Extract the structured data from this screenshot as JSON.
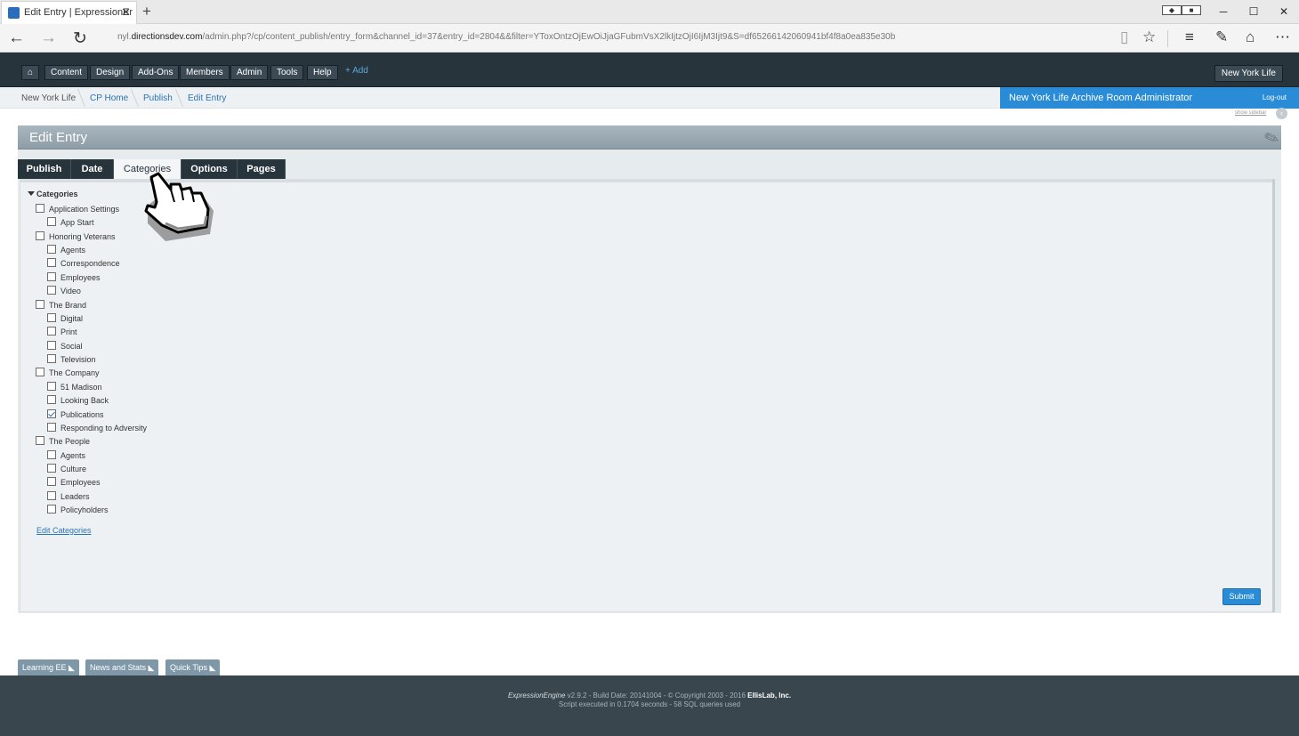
{
  "browser": {
    "tab_title": "Edit Entry | ExpressionEr",
    "url_prefix": "nyl.",
    "url_domain": "directionsdev.com",
    "url_path": "/admin.php?/cp/content_publish/entry_form&channel_id=37&entry_id=2804&&filter=YToxOntzOjEwOiJjaGFubmVsX2lkIjtzOjI6IjM3Ijt9&S=df65266142060941bf4f8a0ea835e30b"
  },
  "nav": {
    "items": [
      "Content",
      "Design",
      "Add-Ons",
      "Members",
      "Admin",
      "Tools",
      "Help"
    ],
    "add_label": "+ Add",
    "site_label": "New York Life"
  },
  "breadcrumb": [
    "New York Life",
    "CP Home",
    "Publish",
    "Edit Entry"
  ],
  "user": {
    "name": "New York Life Archive Room Administrator",
    "logout": "Log-out",
    "show_sidebar": "show sidebar"
  },
  "page": {
    "title": "Edit Entry",
    "tabs": [
      "Publish",
      "Date",
      "Categories",
      "Options",
      "Pages"
    ],
    "active_tab": "Categories"
  },
  "categories": {
    "heading": "Categories",
    "rows": [
      {
        "label": "Application Settings",
        "level": 0,
        "checked": false
      },
      {
        "label": "App Start",
        "level": 1,
        "checked": false
      },
      {
        "label": "Honoring Veterans",
        "level": 0,
        "checked": false
      },
      {
        "label": "Agents",
        "level": 1,
        "checked": false
      },
      {
        "label": "Correspondence",
        "level": 1,
        "checked": false
      },
      {
        "label": "Employees",
        "level": 1,
        "checked": false
      },
      {
        "label": "Video",
        "level": 1,
        "checked": false
      },
      {
        "label": "The Brand",
        "level": 0,
        "checked": false
      },
      {
        "label": "Digital",
        "level": 1,
        "checked": false
      },
      {
        "label": "Print",
        "level": 1,
        "checked": false
      },
      {
        "label": "Social",
        "level": 1,
        "checked": false
      },
      {
        "label": "Television",
        "level": 1,
        "checked": false
      },
      {
        "label": "The Company",
        "level": 0,
        "checked": false
      },
      {
        "label": "51 Madison",
        "level": 1,
        "checked": false
      },
      {
        "label": "Looking Back",
        "level": 1,
        "checked": false
      },
      {
        "label": "Publications",
        "level": 1,
        "checked": true
      },
      {
        "label": "Responding to Adversity",
        "level": 1,
        "checked": false
      },
      {
        "label": "The People",
        "level": 0,
        "checked": false
      },
      {
        "label": "Agents",
        "level": 1,
        "checked": false
      },
      {
        "label": "Culture",
        "level": 1,
        "checked": false
      },
      {
        "label": "Employees",
        "level": 1,
        "checked": false
      },
      {
        "label": "Leaders",
        "level": 1,
        "checked": false
      },
      {
        "label": "Policyholders",
        "level": 1,
        "checked": false
      }
    ],
    "edit_link": "Edit Categories"
  },
  "submit_label": "Submit",
  "accessories": [
    "Learning EE",
    "News and Stats",
    "Quick Tips"
  ],
  "footer": {
    "logo": "ExpressionEngine",
    "build": "v2.9.2 - Build Date: 20141004 - © Copyright 2003 - 2016",
    "company": "EllisLab, Inc.",
    "stats": "Script executed in 0.1704 seconds - 58 SQL queries used"
  }
}
